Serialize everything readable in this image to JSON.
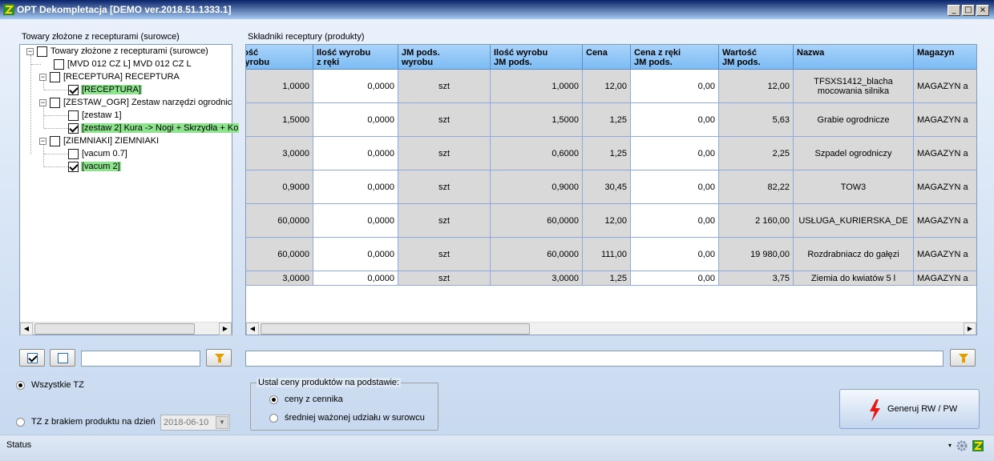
{
  "window": {
    "title": "OPT Dekompletacja [DEMO ver.2018.51.1333.1]",
    "min_glyph": "_",
    "max_glyph": "□",
    "close_glyph": "×"
  },
  "left_panel": {
    "label": "Towary złożone z recepturami (surowce)",
    "tree": [
      {
        "label": "Towary złożone z recepturami (surowce)",
        "checked": false,
        "selected": false
      },
      {
        "label": "[MVD 012 CZ L] MVD 012 CZ L",
        "checked": false,
        "selected": false
      },
      {
        "label": "[RECEPTURA] RECEPTURA",
        "checked": false,
        "selected": false
      },
      {
        "label": "[RECEPTURA]",
        "checked": true,
        "selected": true
      },
      {
        "label": "[ZESTAW_OGR] Zestaw narzędzi ogrodnic",
        "checked": false,
        "selected": false
      },
      {
        "label": "[zestaw 1]",
        "checked": false,
        "selected": false
      },
      {
        "label": "[zestaw 2] Kura -> Nogi + Skrzydła + Ko",
        "checked": true,
        "selected": true
      },
      {
        "label": "[ZIEMNIAKI] ZIEMNIAKI",
        "checked": false,
        "selected": false
      },
      {
        "label": "[vacum 0.7]",
        "checked": false,
        "selected": false
      },
      {
        "label": "[vacum 2]",
        "checked": true,
        "selected": true
      }
    ]
  },
  "right_panel": {
    "label": "Składniki receptury (produkty)",
    "columns": [
      "Ilość\nwyrobu",
      "Ilość wyrobu\nz ręki",
      "JM pods.\nwyrobu",
      "Ilość wyrobu\nJM pods.",
      "Cena",
      "Cena z ręki\nJM pods.",
      "Wartość\nJM pods.",
      "Nazwa",
      "Magazyn"
    ],
    "rows": [
      [
        "1,0000",
        "0,0000",
        "szt",
        "1,0000",
        "12,00",
        "0,00",
        "12,00",
        "TFSXS1412_blacha mocowania silnika",
        "MAGAZYN a"
      ],
      [
        "1,5000",
        "0,0000",
        "szt",
        "1,5000",
        "1,25",
        "0,00",
        "5,63",
        "Grabie ogrodnicze",
        "MAGAZYN a"
      ],
      [
        "3,0000",
        "0,0000",
        "szt",
        "0,6000",
        "1,25",
        "0,00",
        "2,25",
        "Szpadel ogrodniczy",
        "MAGAZYN a"
      ],
      [
        "0,9000",
        "0,0000",
        "szt",
        "0,9000",
        "30,45",
        "0,00",
        "82,22",
        "TOW3",
        "MAGAZYN a"
      ],
      [
        "60,0000",
        "0,0000",
        "szt",
        "60,0000",
        "12,00",
        "0,00",
        "2 160,00",
        "USŁUGA_KURIERSKA_DE",
        "MAGAZYN a"
      ],
      [
        "60,0000",
        "0,0000",
        "szt",
        "60,0000",
        "111,00",
        "0,00",
        "19 980,00",
        "Rozdrabniacz do gałęzi",
        "MAGAZYN a"
      ],
      [
        "3,0000",
        "0,0000",
        "szt",
        "3,0000",
        "1,25",
        "0,00",
        "3,75",
        "Ziemia do kwiatów 5 l",
        "MAGAZYN a"
      ]
    ]
  },
  "filters": {
    "left_search_value": "",
    "right_search_value": ""
  },
  "options": {
    "radio_all_label": "Wszystkie TZ",
    "radio_missing_label": "TZ z brakiem produktu na dzień",
    "date_value": "2018-06-10",
    "selected": "all"
  },
  "price_group": {
    "legend": "Ustal ceny produktów na podstawie:",
    "option1": "ceny z cennika",
    "option2": "średniej ważonej udziału w surowcu",
    "selected": "option1"
  },
  "generate_button": {
    "label": "Generuj RW / PW"
  },
  "status": {
    "text": "Status"
  },
  "colors": {
    "selected_node": "#8ee38e",
    "header_blue": "#7cbcf4",
    "grid_line": "#8fa8e0"
  }
}
